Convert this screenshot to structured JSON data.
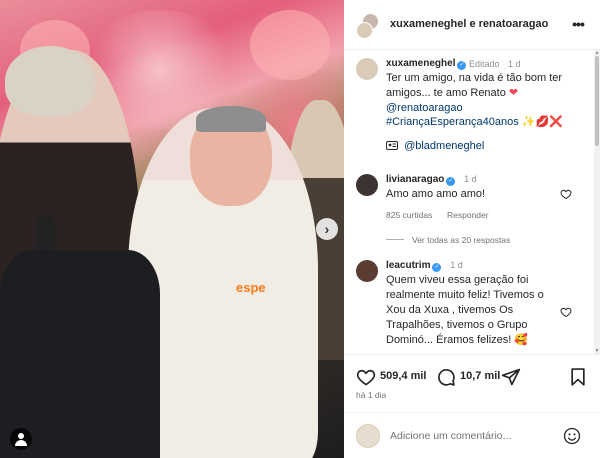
{
  "post": {
    "header_title": "xuxameneghel e renatoaragao",
    "media_shirt_text": "espe",
    "carousel_arrow": "›"
  },
  "caption": {
    "username": "xuxameneghel",
    "edited": "Editado",
    "time": "1 d",
    "text": "Ter um amigo, na vida é tão bom ter amigos... te amo Renato",
    "mention": "@renatoaragao",
    "hashtag": "#CriançaEsperança40anos",
    "emojis": "✨💋❌",
    "heart": "❤",
    "tagged_label": "@bladmeneghel"
  },
  "comments": [
    {
      "username": "livianaragao",
      "time": "1 d",
      "text": "Amo amo amo amo!",
      "likes": "825 curtidas",
      "reply": "Responder",
      "view_replies": "Ver todas as 20 respostas"
    },
    {
      "username": "leacutrim",
      "time": "1 d",
      "text": "Quem viveu essa geração foi realmente muito feliz! Tivemos o Xou da Xuxa , tivemos Os Trapalhões, tivemos o Grupo Dominó... Éramos felizes!",
      "emoji": "🥰"
    }
  ],
  "actions": {
    "likes": "509,4 mil",
    "comments": "10,7 mil",
    "time_ago": "há 1 dia"
  },
  "add_comment": {
    "placeholder": "Adicione um comentário..."
  },
  "colors": {
    "accent_blue": "#3897f0",
    "link_blue": "#00376b",
    "heart_red": "#ed4956"
  }
}
